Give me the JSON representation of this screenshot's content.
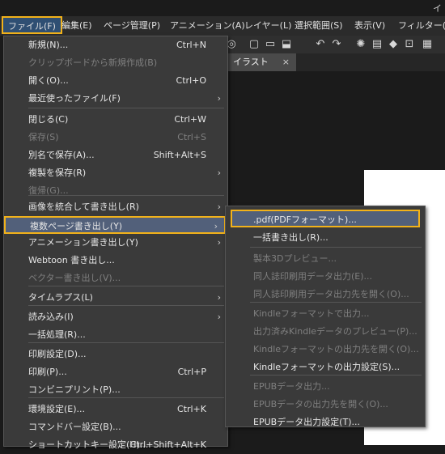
{
  "titlebar": {
    "text": "イ"
  },
  "menubar": {
    "items": [
      "ファイル(F)",
      "編集(E)",
      "ページ管理(P)",
      "アニメーション(A)",
      "レイヤー(L)",
      "選択範囲(S)",
      "表示(V)",
      "フィルター(I)"
    ]
  },
  "tab": {
    "title": "イラスト",
    "close": "×"
  },
  "file_menu": {
    "items": [
      {
        "label": "新規(N)...",
        "shortcut": "Ctrl+N"
      },
      {
        "label": "クリップボードから新規作成(B)",
        "disabled": true
      },
      {
        "label": "開く(O)...",
        "shortcut": "Ctrl+O"
      },
      {
        "label": "最近使ったファイル(F)",
        "submenu": true
      },
      {
        "label": "閉じる(C)",
        "shortcut": "Ctrl+W"
      },
      {
        "label": "保存(S)",
        "shortcut": "Ctrl+S",
        "disabled": true
      },
      {
        "label": "別名で保存(A)...",
        "shortcut": "Shift+Alt+S"
      },
      {
        "label": "複製を保存(R)",
        "submenu": true
      },
      {
        "label": "復帰(G)...",
        "disabled": true
      },
      {
        "label": "画像を統合して書き出し(R)",
        "submenu": true
      },
      {
        "label": "複数ページ書き出し(Y)",
        "submenu": true
      },
      {
        "label": "アニメーション書き出し(Y)",
        "submenu": true
      },
      {
        "label": "Webtoon 書き出し..."
      },
      {
        "label": "ベクター書き出し(V)...",
        "disabled": true
      },
      {
        "label": "タイムラプス(L)",
        "submenu": true
      },
      {
        "label": "読み込み(I)",
        "submenu": true
      },
      {
        "label": "一括処理(R)..."
      },
      {
        "label": "印刷設定(D)..."
      },
      {
        "label": "印刷(P)...",
        "shortcut": "Ctrl+P"
      },
      {
        "label": "コンビニプリント(P)..."
      },
      {
        "label": "環境設定(E)...",
        "shortcut": "Ctrl+K"
      },
      {
        "label": "コマンドバー設定(B)..."
      },
      {
        "label": "ショートカットキー設定(H)...",
        "shortcut": "Ctrl+Shift+Alt+K"
      }
    ],
    "arrow": "›"
  },
  "submenu": {
    "items": [
      {
        "label": ".pdf(PDFフォーマット)..."
      },
      {
        "label": "一括書き出し(R)..."
      },
      {
        "label": "製本3Dプレビュー...",
        "disabled": true
      },
      {
        "label": "同人誌印刷用データ出力(E)...",
        "disabled": true
      },
      {
        "label": "同人誌印刷用データ出力先を開く(O)...",
        "disabled": true
      },
      {
        "label": "Kindleフォーマットで出力...",
        "disabled": true
      },
      {
        "label": "出力済みKindleデータのプレビュー(P)...",
        "disabled": true
      },
      {
        "label": "Kindleフォーマットの出力先を開く(O)...",
        "disabled": true
      },
      {
        "label": "Kindleフォーマットの出力設定(S)..."
      },
      {
        "label": "EPUBデータ出力...",
        "disabled": true
      },
      {
        "label": "EPUBデータの出力先を開く(O)...",
        "disabled": true
      },
      {
        "label": "EPUBデータ出力設定(T)..."
      }
    ]
  },
  "colors": {
    "highlight": "#f2b21a",
    "menu_bg": "#3a3a3a",
    "selected_row": "#52607a"
  }
}
